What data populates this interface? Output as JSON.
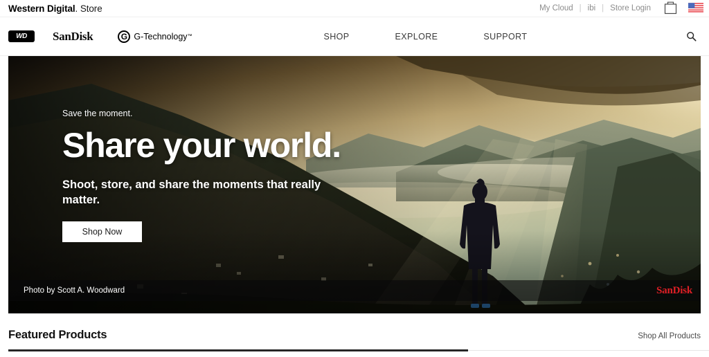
{
  "utility": {
    "brand_bold": "Western Digital",
    "brand_light": ". Store",
    "links": [
      {
        "label": "My Cloud",
        "name": "utility-link-my-cloud"
      },
      {
        "label": "ibi",
        "name": "utility-link-ibi"
      },
      {
        "label": "Store Login",
        "name": "utility-link-store-login"
      }
    ],
    "separator": "|",
    "cart_icon": "shopping-bag-icon",
    "flag_icon": "us-flag-icon"
  },
  "header": {
    "logos": [
      {
        "label": "WD",
        "name": "logo-wd"
      },
      {
        "label": "SanDisk",
        "name": "logo-sandisk"
      },
      {
        "label": "G-Technology",
        "name": "logo-g-technology",
        "mark": "G",
        "tm": "™"
      }
    ],
    "nav": [
      {
        "label": "SHOP",
        "name": "nav-item-shop"
      },
      {
        "label": "EXPLORE",
        "name": "nav-item-explore"
      },
      {
        "label": "SUPPORT",
        "name": "nav-item-support"
      }
    ],
    "search_icon": "search-icon"
  },
  "hero": {
    "eyebrow": "Save the moment.",
    "title": "Share your world.",
    "subtitle": "Shoot, store, and share the moments that really matter.",
    "cta_label": "Shop Now",
    "photo_credit": "Photo by Scott A. Woodward",
    "brand_watermark": "SanDisk",
    "brand_watermark_color": "#e01f26",
    "image_description": "Silhouette of a person in a long coat standing on a ridge overlooking a misty mountain valley at golden hour"
  },
  "featured": {
    "title": "Featured Products",
    "shop_all_label": "Shop All Products"
  }
}
